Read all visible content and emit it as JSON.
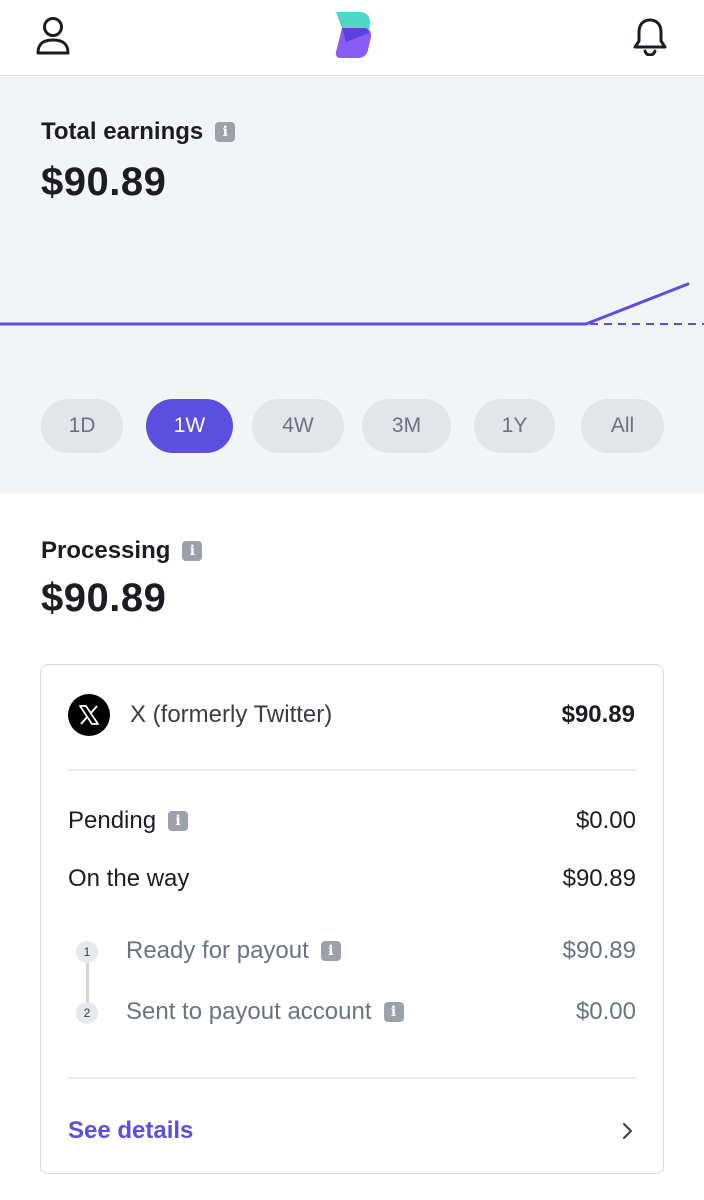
{
  "header": {
    "profile_icon": "person-outline-icon",
    "logo": "stacked-app-logo",
    "bell_icon": "bell-outline-icon"
  },
  "earnings": {
    "label": "Total earnings",
    "amount": "$90.89",
    "ranges": [
      "1D",
      "1W",
      "4W",
      "3M",
      "1Y",
      "All"
    ],
    "selected_range": "1W",
    "line_color": "#5b4fe0"
  },
  "processing": {
    "label": "Processing",
    "amount": "$90.89"
  },
  "card": {
    "platform_name": "X (formerly Twitter)",
    "platform_amount": "$90.89",
    "pending_label": "Pending",
    "pending_value": "$0.00",
    "on_the_way_label": "On the way",
    "on_the_way_value": "$90.89",
    "steps": [
      {
        "num": "1",
        "label": "Ready for payout",
        "value": "$90.89"
      },
      {
        "num": "2",
        "label": "Sent to payout account",
        "value": "$0.00"
      }
    ],
    "see_details": "See details"
  },
  "colors": {
    "accent": "#5b4fe0",
    "panel_bg": "#f3f4f6",
    "pill_bg": "#e3e5e9"
  }
}
